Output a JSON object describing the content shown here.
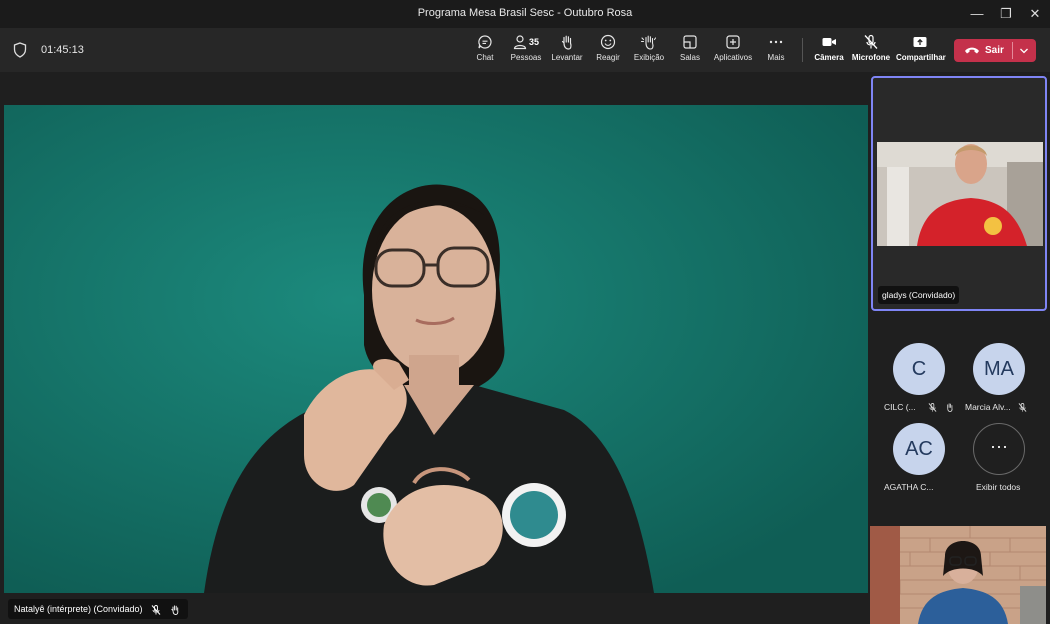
{
  "window": {
    "title": "Programa Mesa Brasil Sesc - Outubro Rosa",
    "controls": {
      "minimize": "—",
      "restore": "❐",
      "close": "✕"
    }
  },
  "toolbar": {
    "timer": "01:45:13",
    "buttons": {
      "chat": "Chat",
      "pessoas": "Pessoas",
      "pessoas_count": "35",
      "levantar": "Levantar",
      "reagir": "Reagir",
      "exibicao": "Exibição",
      "salas": "Salas",
      "aplicativos": "Aplicativos",
      "mais": "Mais",
      "camera": "Câmera",
      "microfone": "Microfone",
      "compartilhar": "Compartilhar"
    },
    "leave_label": "Sair",
    "leave_color": "#c4314b"
  },
  "main_video": {
    "participant": "Natalyê (intérprete) (Convidado)"
  },
  "side_panel": {
    "featured": {
      "name": "gladys (Convidado)",
      "accent": "#7f85f5"
    },
    "participants": [
      {
        "initials": "C",
        "label": "CILC (..."
      },
      {
        "initials": "MA",
        "label": "Marcia Alv..."
      },
      {
        "initials": "AC",
        "label": "AGATHA C..."
      }
    ],
    "show_all": {
      "glyph": "···",
      "label": "Exibir todos"
    }
  }
}
